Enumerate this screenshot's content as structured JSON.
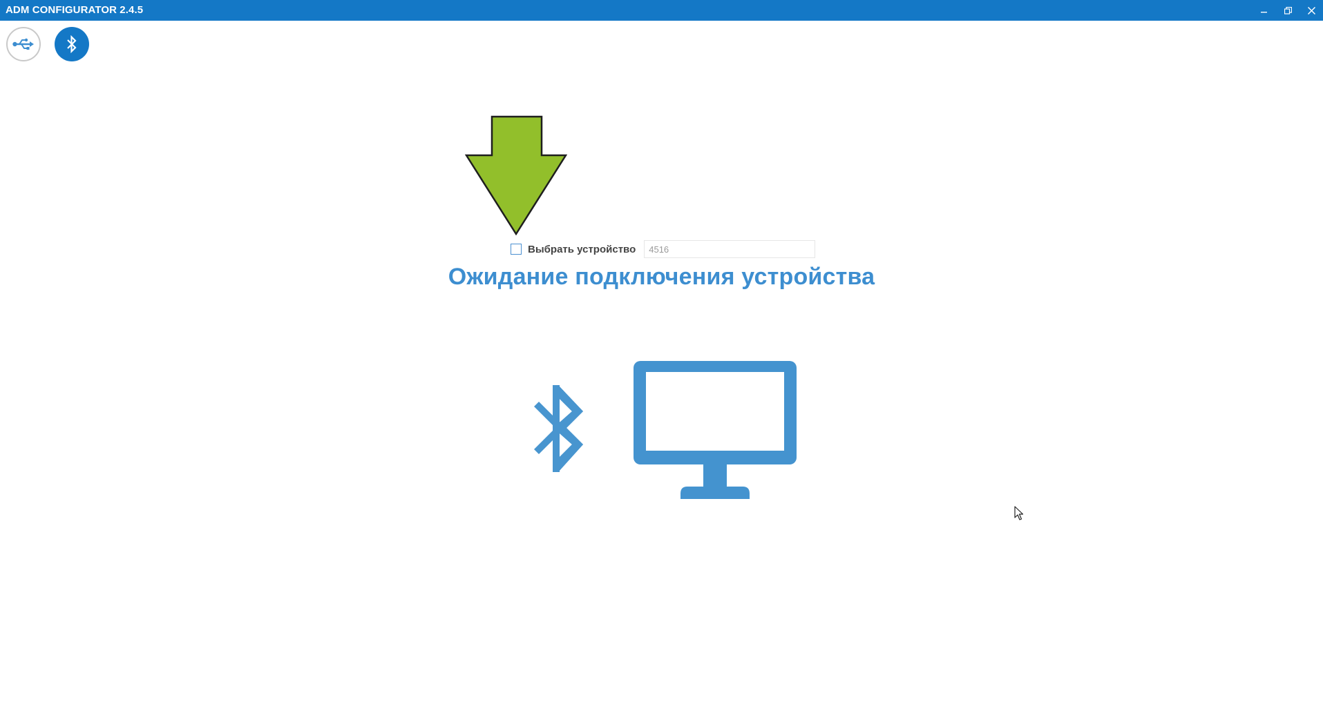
{
  "window": {
    "title": "ADM CONFIGURATOR 2.4.5",
    "controls": [
      "minimize-icon",
      "restore-icon",
      "close-icon"
    ]
  },
  "toolbar": {
    "buttons": [
      {
        "name": "usb",
        "icon": "usb-icon",
        "active": false
      },
      {
        "name": "bluetooth",
        "icon": "bluetooth-icon",
        "active": true
      }
    ]
  },
  "device_select": {
    "checkbox_label": "Выбрать устройство",
    "checked": false,
    "input_value": "4516"
  },
  "status": {
    "title": "Ожидание подключения устройства"
  },
  "illustration": {
    "icons": [
      "bluetooth-icon",
      "monitor-icon"
    ],
    "arrow_icon": "arrow-down-icon"
  },
  "colors": {
    "titlebar": "#1478c6",
    "accent": "#3d8ed0",
    "arrow": "#92bf2b",
    "illustration": "#4895cf"
  }
}
